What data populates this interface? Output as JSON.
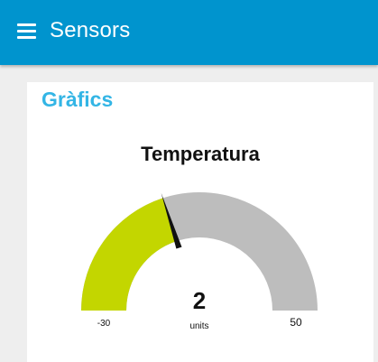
{
  "toolbar": {
    "menu_icon": "hamburger-icon",
    "title": "Sensors",
    "background": "#0094ce"
  },
  "group": {
    "title": "Gràfics",
    "title_color": "#33b5e5"
  },
  "gauge": {
    "title": "Temperatura",
    "value": 2,
    "value_label": "2",
    "units": "units",
    "min": -30,
    "max": 50,
    "min_label": "-30",
    "max_label": "50",
    "fill_color": "#c3d600",
    "track_color": "#bdbdbd",
    "needle_color": "#111111"
  }
}
